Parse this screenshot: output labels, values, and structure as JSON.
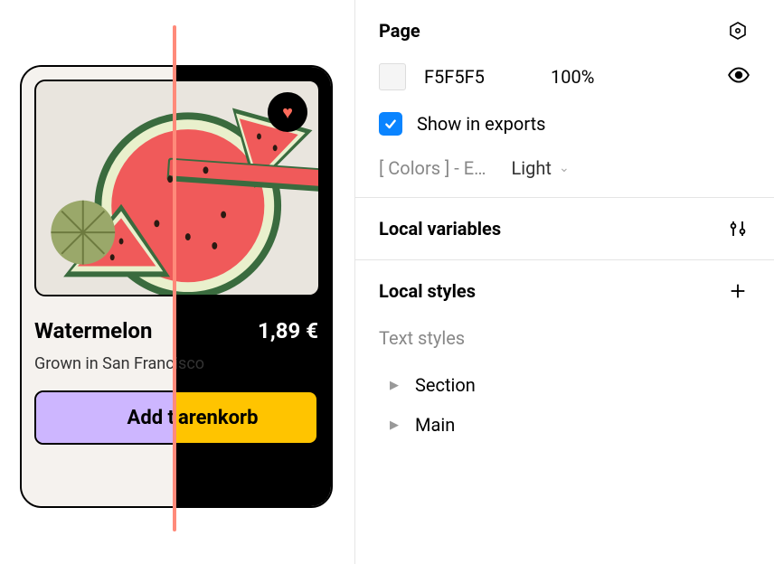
{
  "card": {
    "title": "Watermelon",
    "price": "1,89 €",
    "subtitle": "Grown in San Francisco",
    "button_left": "Add t",
    "button_right": "arenkorb"
  },
  "panel": {
    "page_title": "Page",
    "fill": {
      "hex": "F5F5F5",
      "opacity": "100%"
    },
    "exports_label": "Show in exports",
    "mode": {
      "collection": "[ Colors ] - E…",
      "value": "Light"
    },
    "local_variables_title": "Local variables",
    "local_styles_title": "Local styles",
    "text_styles_label": "Text styles",
    "styles": [
      {
        "name": "Section"
      },
      {
        "name": "Main"
      }
    ]
  }
}
